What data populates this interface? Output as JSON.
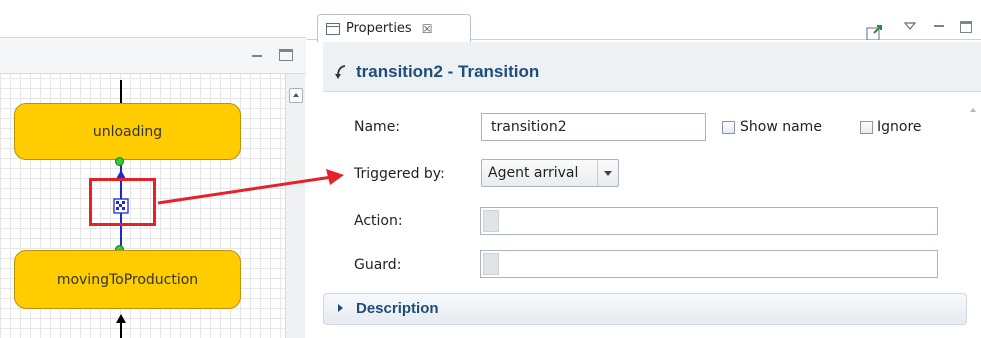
{
  "properties_view": {
    "tab_label": "Properties",
    "tab_close": "☒",
    "title": "transition2 - Transition",
    "fields": {
      "name_label": "Name:",
      "name_value": "transition2",
      "show_name_label": "Show name",
      "ignore_label": "Ignore",
      "triggered_label": "Triggered by:",
      "triggered_value": "Agent arrival",
      "action_label": "Action:",
      "guard_label": "Guard:"
    },
    "description_label": "Description"
  },
  "diagram": {
    "states": [
      "unloading",
      "movingToProduction"
    ]
  },
  "colors": {
    "state_fill": "#ffcc00",
    "highlight": "#e8202a",
    "title_text": "#1e4e78"
  },
  "icons": [
    "transition-icon",
    "pin-icon",
    "view-menu-icon",
    "minimize-icon",
    "maximize-icon",
    "properties-icon"
  ]
}
